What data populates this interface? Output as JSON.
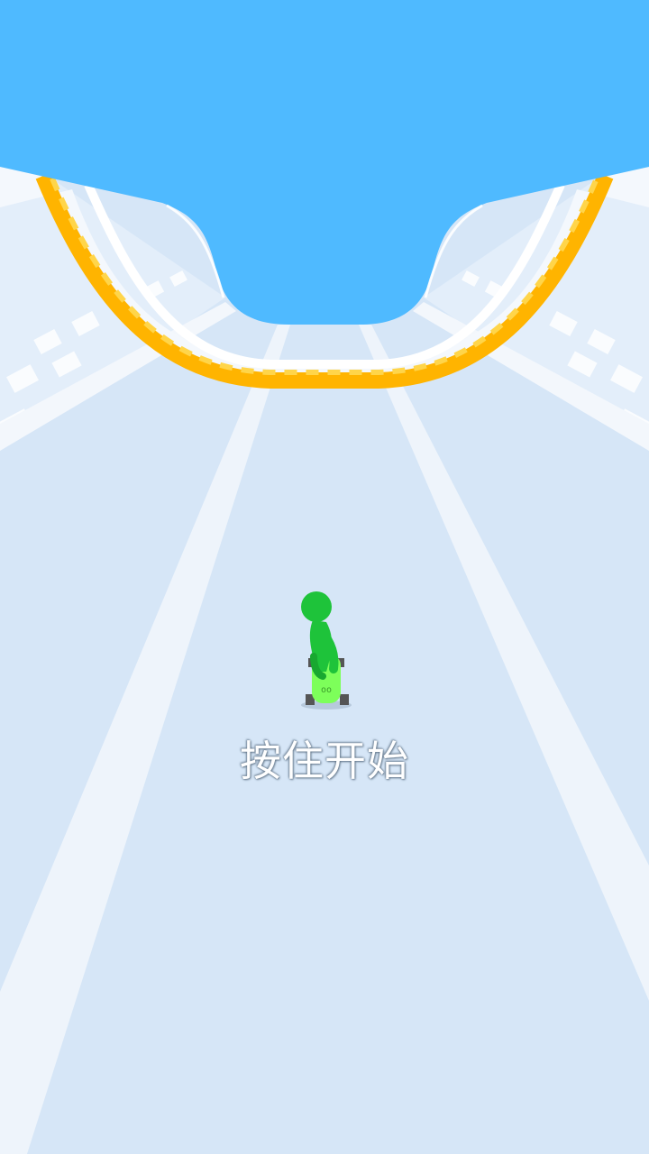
{
  "game": {
    "start_hint": "按住开始"
  },
  "colors": {
    "sky": "#4fbaff",
    "track": "#d6e6f7",
    "rail_orange": "#ffb400",
    "rail_yellow": "#ffd54a",
    "player_body": "#1ec33a",
    "skateboard": "#7dff5a"
  },
  "icons": {
    "player": "green-stickman-on-skateboard"
  }
}
